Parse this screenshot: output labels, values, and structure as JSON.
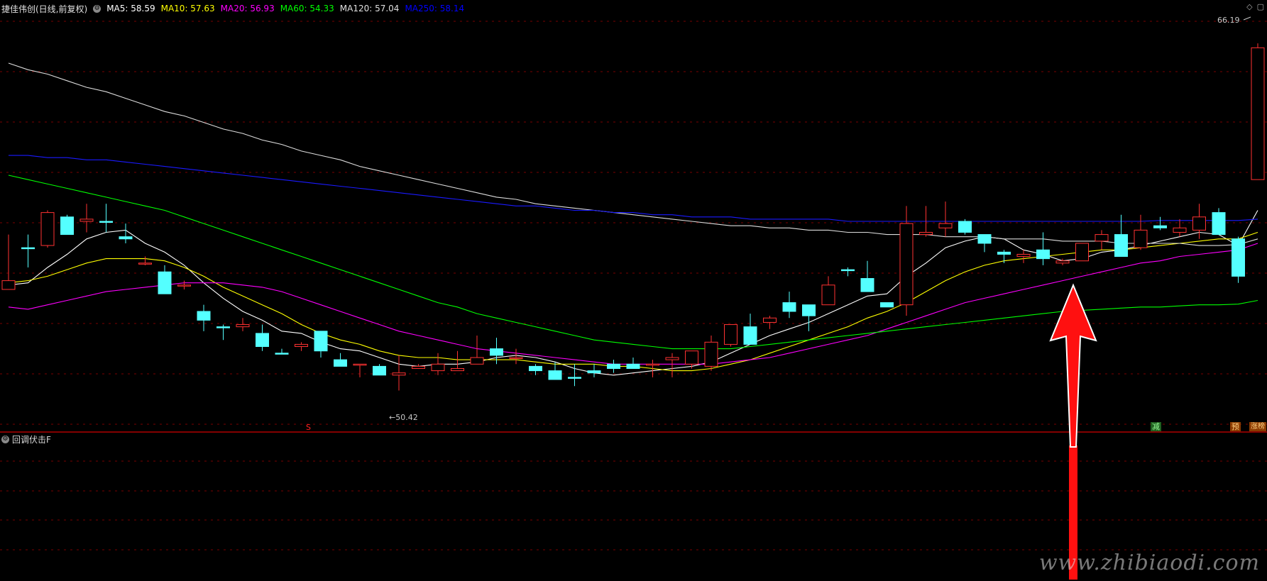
{
  "header": {
    "stock_title": "捷佳伟创(日线,前复权)",
    "ma_labels": [
      {
        "text": "MA5: 58.59",
        "color": "#ffffff"
      },
      {
        "text": "MA10: 57.63",
        "color": "#ffff00"
      },
      {
        "text": "MA20: 56.93",
        "color": "#ff00ff"
      },
      {
        "text": "MA60: 54.33",
        "color": "#00ff00"
      },
      {
        "text": "MA120: 57.04",
        "color": "#e0e0e0"
      },
      {
        "text": "MA250: 58.14",
        "color": "#0000ff"
      }
    ]
  },
  "price_axis": {
    "min": 48.8,
    "max": 67.4
  },
  "chart_data": {
    "type": "candlestick",
    "high_marker": "66.19",
    "low_marker": "←50.42",
    "candles": [
      {
        "o": 55.0,
        "h": 57.5,
        "l": 55.6,
        "c": 55.4,
        "up": true
      },
      {
        "o": 56.9,
        "h": 57.5,
        "l": 56.0,
        "c": 56.9,
        "up": false
      },
      {
        "o": 57.0,
        "h": 58.6,
        "l": 56.9,
        "c": 58.5,
        "up": true
      },
      {
        "o": 58.3,
        "h": 58.4,
        "l": 57.6,
        "c": 57.5,
        "up": false
      },
      {
        "o": 58.1,
        "h": 58.9,
        "l": 57.6,
        "c": 58.2,
        "up": true
      },
      {
        "o": 58.1,
        "h": 58.9,
        "l": 57.6,
        "c": 58.1,
        "up": false
      },
      {
        "o": 57.4,
        "h": 58.0,
        "l": 57.1,
        "c": 57.3,
        "up": false
      },
      {
        "o": 56.2,
        "h": 56.5,
        "l": 56.1,
        "c": 56.2,
        "up": true
      },
      {
        "o": 55.8,
        "h": 56.1,
        "l": 54.8,
        "c": 54.8,
        "up": false
      },
      {
        "o": 55.2,
        "h": 55.4,
        "l": 55.0,
        "c": 55.2,
        "up": true
      },
      {
        "o": 54.0,
        "h": 54.3,
        "l": 53.1,
        "c": 53.6,
        "up": false
      },
      {
        "o": 53.3,
        "h": 53.4,
        "l": 52.7,
        "c": 53.3,
        "up": false
      },
      {
        "o": 53.3,
        "h": 53.7,
        "l": 53.1,
        "c": 53.4,
        "up": true
      },
      {
        "o": 53.0,
        "h": 53.4,
        "l": 52.2,
        "c": 52.4,
        "up": false
      },
      {
        "o": 52.1,
        "h": 52.3,
        "l": 52.1,
        "c": 52.1,
        "up": false
      },
      {
        "o": 52.4,
        "h": 52.6,
        "l": 52.2,
        "c": 52.5,
        "up": true
      },
      {
        "o": 53.1,
        "h": 53.1,
        "l": 51.9,
        "c": 52.2,
        "up": false
      },
      {
        "o": 51.8,
        "h": 52.1,
        "l": 51.5,
        "c": 51.5,
        "up": false
      },
      {
        "o": 51.6,
        "h": 51.6,
        "l": 51.0,
        "c": 51.6,
        "up": true
      },
      {
        "o": 51.5,
        "h": 51.6,
        "l": 51.1,
        "c": 51.1,
        "up": false
      },
      {
        "o": 51.1,
        "h": 52.0,
        "l": 50.4,
        "c": 51.2,
        "up": true
      },
      {
        "o": 51.5,
        "h": 51.6,
        "l": 51.4,
        "c": 51.4,
        "up": true
      },
      {
        "o": 51.3,
        "h": 52.1,
        "l": 51.1,
        "c": 51.6,
        "up": true
      },
      {
        "o": 51.3,
        "h": 52.2,
        "l": 51.6,
        "c": 51.4,
        "up": true
      },
      {
        "o": 51.9,
        "h": 52.9,
        "l": 51.6,
        "c": 51.6,
        "up": true
      },
      {
        "o": 52.3,
        "h": 52.8,
        "l": 51.6,
        "c": 52.0,
        "up": false
      },
      {
        "o": 51.9,
        "h": 52.3,
        "l": 51.6,
        "c": 51.9,
        "up": true
      },
      {
        "o": 51.5,
        "h": 51.6,
        "l": 51.1,
        "c": 51.3,
        "up": false
      },
      {
        "o": 51.3,
        "h": 51.7,
        "l": 50.9,
        "c": 50.9,
        "up": false
      },
      {
        "o": 51.0,
        "h": 51.6,
        "l": 50.6,
        "c": 51.0,
        "up": false
      },
      {
        "o": 51.3,
        "h": 51.6,
        "l": 51.0,
        "c": 51.2,
        "up": false
      },
      {
        "o": 51.6,
        "h": 51.8,
        "l": 51.2,
        "c": 51.4,
        "up": false
      },
      {
        "o": 51.6,
        "h": 51.9,
        "l": 51.4,
        "c": 51.4,
        "up": false
      },
      {
        "o": 51.6,
        "h": 51.8,
        "l": 51.0,
        "c": 51.6,
        "up": true
      },
      {
        "o": 51.8,
        "h": 52.1,
        "l": 51.0,
        "c": 51.9,
        "up": true
      },
      {
        "o": 52.2,
        "h": 52.2,
        "l": 51.4,
        "c": 51.6,
        "up": true
      },
      {
        "o": 51.5,
        "h": 52.9,
        "l": 51.3,
        "c": 52.6,
        "up": true
      },
      {
        "o": 52.5,
        "h": 53.4,
        "l": 52.4,
        "c": 53.4,
        "up": true
      },
      {
        "o": 53.3,
        "h": 53.9,
        "l": 53.1,
        "c": 52.5,
        "up": false
      },
      {
        "o": 53.5,
        "h": 53.8,
        "l": 53.2,
        "c": 53.7,
        "up": true
      },
      {
        "o": 54.4,
        "h": 54.9,
        "l": 53.7,
        "c": 54.0,
        "up": false
      },
      {
        "o": 53.8,
        "h": 54.1,
        "l": 53.1,
        "c": 54.3,
        "up": false
      },
      {
        "o": 54.3,
        "h": 55.6,
        "l": 54.6,
        "c": 55.2,
        "up": true
      },
      {
        "o": 55.9,
        "h": 56.0,
        "l": 55.6,
        "c": 55.9,
        "up": false
      },
      {
        "o": 55.5,
        "h": 56.3,
        "l": 55.0,
        "c": 54.9,
        "up": false
      },
      {
        "o": 54.4,
        "h": 54.4,
        "l": 54.2,
        "c": 54.2,
        "up": false
      },
      {
        "o": 54.3,
        "h": 58.8,
        "l": 53.8,
        "c": 58.0,
        "up": true
      },
      {
        "o": 57.6,
        "h": 58.8,
        "l": 57.4,
        "c": 57.5,
        "up": true
      },
      {
        "o": 57.8,
        "h": 59.0,
        "l": 57.4,
        "c": 58.0,
        "up": true
      },
      {
        "o": 58.1,
        "h": 58.2,
        "l": 57.5,
        "c": 57.6,
        "up": false
      },
      {
        "o": 57.5,
        "h": 57.4,
        "l": 56.7,
        "c": 57.1,
        "up": false
      },
      {
        "o": 56.7,
        "h": 56.8,
        "l": 56.2,
        "c": 56.6,
        "up": false
      },
      {
        "o": 56.5,
        "h": 56.8,
        "l": 56.2,
        "c": 56.6,
        "up": true
      },
      {
        "o": 56.8,
        "h": 57.6,
        "l": 56.1,
        "c": 56.4,
        "up": false
      },
      {
        "o": 56.3,
        "h": 56.4,
        "l": 56.1,
        "c": 56.2,
        "up": true
      },
      {
        "o": 56.3,
        "h": 57.1,
        "l": 56.3,
        "c": 57.1,
        "up": true
      },
      {
        "o": 57.2,
        "h": 57.7,
        "l": 56.8,
        "c": 57.5,
        "up": true
      },
      {
        "o": 57.5,
        "h": 58.4,
        "l": 56.8,
        "c": 56.5,
        "up": false
      },
      {
        "o": 56.9,
        "h": 58.4,
        "l": 56.8,
        "c": 57.7,
        "up": true
      },
      {
        "o": 57.9,
        "h": 58.3,
        "l": 57.7,
        "c": 57.8,
        "up": false
      },
      {
        "o": 57.6,
        "h": 58.2,
        "l": 57.4,
        "c": 57.8,
        "up": true
      },
      {
        "o": 57.7,
        "h": 58.9,
        "l": 57.3,
        "c": 58.3,
        "up": true
      },
      {
        "o": 58.5,
        "h": 58.7,
        "l": 57.6,
        "c": 57.5,
        "up": false
      },
      {
        "o": 57.3,
        "h": 57.4,
        "l": 55.3,
        "c": 55.6,
        "up": false
      },
      {
        "o": 60.0,
        "h": 66.2,
        "l": 60.0,
        "c": 66.0,
        "up": true
      }
    ],
    "ma_series": [
      {
        "name": "MA5",
        "color": "#ffffff",
        "values": [
          55.2,
          55.3,
          56.0,
          56.6,
          57.3,
          57.6,
          57.7,
          57.1,
          56.7,
          56.1,
          55.3,
          54.6,
          54.0,
          53.6,
          53.1,
          53.0,
          52.6,
          52.3,
          52.2,
          51.9,
          51.6,
          51.5,
          51.6,
          51.6,
          51.7,
          51.9,
          52.0,
          51.9,
          51.7,
          51.4,
          51.2,
          51.1,
          51.2,
          51.3,
          51.4,
          51.5,
          51.7,
          52.1,
          52.5,
          52.9,
          53.2,
          53.5,
          53.9,
          54.3,
          54.7,
          54.8,
          55.6,
          56.2,
          56.9,
          57.2,
          57.4,
          57.3,
          56.8,
          56.6,
          56.3,
          56.4,
          56.7,
          56.8,
          57.0,
          57.2,
          57.4,
          57.6,
          57.5,
          57.0,
          58.6
        ]
      },
      {
        "name": "MA10",
        "color": "#ffff00",
        "values": [
          55.3,
          55.4,
          55.6,
          55.9,
          56.2,
          56.4,
          56.4,
          56.4,
          56.3,
          56.0,
          55.6,
          55.1,
          54.7,
          54.3,
          53.9,
          53.4,
          53.0,
          52.7,
          52.5,
          52.2,
          52.0,
          51.9,
          51.9,
          51.8,
          51.8,
          51.8,
          51.8,
          51.7,
          51.6,
          51.6,
          51.6,
          51.5,
          51.5,
          51.4,
          51.3,
          51.3,
          51.4,
          51.6,
          51.8,
          52.1,
          52.4,
          52.7,
          53.0,
          53.3,
          53.7,
          54.0,
          54.4,
          54.9,
          55.4,
          55.8,
          56.1,
          56.3,
          56.4,
          56.5,
          56.6,
          56.7,
          56.8,
          56.8,
          56.9,
          57.0,
          57.1,
          57.2,
          57.3,
          57.3,
          57.6
        ]
      },
      {
        "name": "MA20",
        "color": "#ff00ff",
        "values": [
          54.2,
          54.1,
          54.3,
          54.5,
          54.7,
          54.9,
          55.0,
          55.1,
          55.2,
          55.3,
          55.3,
          55.3,
          55.2,
          55.1,
          54.9,
          54.6,
          54.3,
          54.0,
          53.7,
          53.4,
          53.1,
          52.9,
          52.7,
          52.5,
          52.3,
          52.2,
          52.1,
          52.0,
          51.9,
          51.8,
          51.7,
          51.6,
          51.6,
          51.6,
          51.6,
          51.6,
          51.6,
          51.7,
          51.8,
          51.9,
          52.1,
          52.3,
          52.5,
          52.7,
          52.9,
          53.2,
          53.5,
          53.8,
          54.1,
          54.4,
          54.6,
          54.8,
          55.0,
          55.2,
          55.4,
          55.6,
          55.8,
          56.0,
          56.2,
          56.3,
          56.5,
          56.6,
          56.7,
          56.8,
          57.1
        ]
      },
      {
        "name": "MA60",
        "color": "#00ff00",
        "values": [
          60.2,
          60.0,
          59.8,
          59.6,
          59.4,
          59.2,
          59.0,
          58.8,
          58.6,
          58.3,
          58.0,
          57.7,
          57.4,
          57.1,
          56.8,
          56.5,
          56.2,
          55.9,
          55.6,
          55.3,
          55.0,
          54.7,
          54.4,
          54.2,
          53.9,
          53.7,
          53.5,
          53.3,
          53.1,
          52.9,
          52.7,
          52.6,
          52.5,
          52.4,
          52.3,
          52.3,
          52.3,
          52.3,
          52.4,
          52.5,
          52.6,
          52.7,
          52.8,
          52.9,
          53.0,
          53.1,
          53.2,
          53.3,
          53.4,
          53.5,
          53.6,
          53.7,
          53.8,
          53.9,
          54.0,
          54.05,
          54.1,
          54.15,
          54.2,
          54.2,
          54.25,
          54.3,
          54.3,
          54.33,
          54.5
        ]
      },
      {
        "name": "MA120",
        "color": "#dcdcdc",
        "values": [
          65.3,
          65.0,
          64.8,
          64.5,
          64.2,
          64.0,
          63.7,
          63.4,
          63.1,
          62.9,
          62.6,
          62.3,
          62.1,
          61.8,
          61.6,
          61.3,
          61.1,
          60.9,
          60.6,
          60.4,
          60.2,
          60.0,
          59.8,
          59.6,
          59.4,
          59.2,
          59.1,
          58.9,
          58.8,
          58.7,
          58.6,
          58.5,
          58.4,
          58.3,
          58.2,
          58.1,
          58.0,
          57.9,
          57.9,
          57.8,
          57.8,
          57.7,
          57.7,
          57.6,
          57.6,
          57.5,
          57.5,
          57.5,
          57.4,
          57.4,
          57.4,
          57.3,
          57.3,
          57.3,
          57.2,
          57.2,
          57.2,
          57.1,
          57.1,
          57.1,
          57.1,
          57.0,
          57.0,
          57.04,
          57.3
        ]
      },
      {
        "name": "MA250",
        "color": "#1a1aff",
        "values": [
          61.1,
          61.1,
          61.0,
          61.0,
          60.9,
          60.9,
          60.8,
          60.7,
          60.6,
          60.5,
          60.4,
          60.3,
          60.2,
          60.1,
          60.0,
          59.9,
          59.8,
          59.7,
          59.6,
          59.5,
          59.4,
          59.3,
          59.2,
          59.1,
          59.0,
          58.9,
          58.8,
          58.8,
          58.7,
          58.6,
          58.6,
          58.5,
          58.5,
          58.4,
          58.4,
          58.3,
          58.3,
          58.3,
          58.2,
          58.2,
          58.2,
          58.2,
          58.2,
          58.1,
          58.1,
          58.1,
          58.1,
          58.1,
          58.1,
          58.1,
          58.1,
          58.1,
          58.1,
          58.1,
          58.1,
          58.1,
          58.1,
          58.1,
          58.1,
          58.14,
          58.14,
          58.14,
          58.14,
          58.14,
          58.2
        ]
      }
    ]
  },
  "signals": {
    "s_marker": "S",
    "badge_1": "减",
    "badge_2": "预",
    "badge_3": "涨榜"
  },
  "sub_indicator": {
    "label": "回调伏击F",
    "bar_value": 1
  },
  "watermark": "www.zhibiaodi.com",
  "colors": {
    "up": "#ff3232",
    "down": "#54ffff",
    "separator": "#b00000",
    "grid": "#7a0000",
    "arrow": "#ff1010"
  }
}
